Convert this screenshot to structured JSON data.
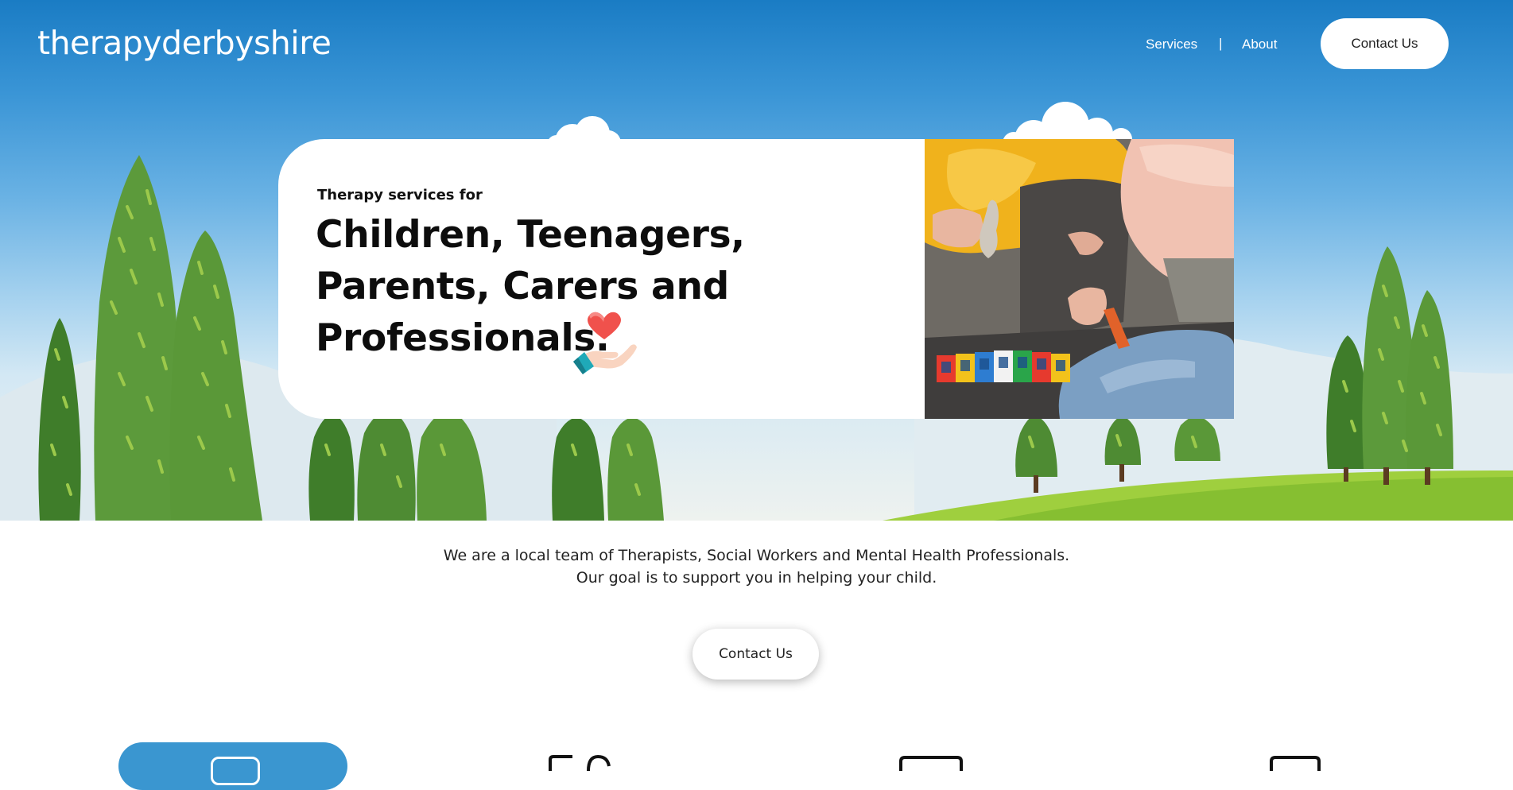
{
  "site": {
    "logo": "therapyderbyshire"
  },
  "nav": {
    "items": [
      "Services",
      "About"
    ],
    "separator": "|",
    "contact_label": "Contact Us"
  },
  "hero": {
    "eyebrow": "Therapy services for",
    "headline": "Children, Teenagers, Parents, Carers and Professionals.",
    "photo_alt": "Adult and child playing with toy figure and building blocks"
  },
  "intro": {
    "line1": "We are a local team of Therapists, Social Workers and Mental Health Professionals.",
    "line2": "Our goal is to support you in helping your child.",
    "contact_label": "Contact Us"
  },
  "icons": [
    "heart-in-hand-icon",
    "chat-icon",
    "laptop-icon",
    "tablet-icon"
  ],
  "colors": {
    "sky_top": "#1a7cc4",
    "tree_green": "#5a9a3c",
    "grass_green": "#8cc540",
    "accent_blue": "#3a96d0"
  }
}
